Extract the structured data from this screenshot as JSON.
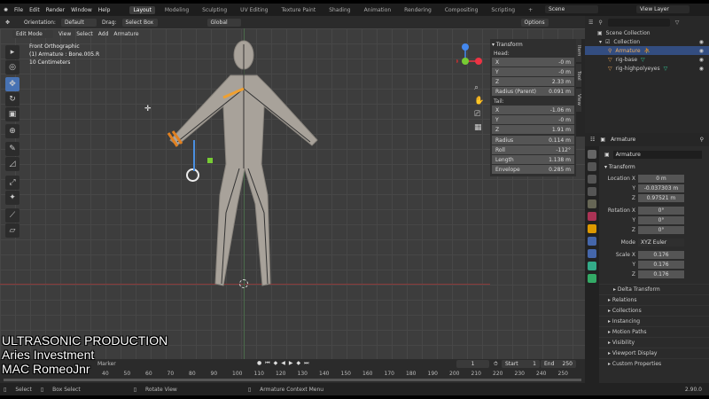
{
  "menu": {
    "items": [
      "File",
      "Edit",
      "Render",
      "Window",
      "Help"
    ],
    "workspaces": [
      "Layout",
      "Modeling",
      "Sculpting",
      "UV Editing",
      "Texture Paint",
      "Shading",
      "Animation",
      "Rendering",
      "Compositing",
      "Scripting",
      "+"
    ],
    "scene": "Scene",
    "view_layer": "View Layer"
  },
  "header": {
    "orientation_label": "Orientation:",
    "orientation": "Default",
    "drag_label": "Drag:",
    "drag": "Select Box",
    "transform_space": "Global",
    "options": "Options"
  },
  "viewport": {
    "mode": "Edit Mode",
    "menus": [
      "View",
      "Select",
      "Add",
      "Armature"
    ],
    "info": [
      "Front Orthographic",
      "(1) Armature : Bone.005.R",
      "10 Centimeters"
    ]
  },
  "npanel": {
    "tabs": [
      "Item",
      "Tool",
      "View"
    ],
    "title": "Transform",
    "head_label": "Head:",
    "head": [
      {
        "k": "X",
        "v": "-0 m"
      },
      {
        "k": "Y",
        "v": "-0 m"
      },
      {
        "k": "Z",
        "v": "2.33 m"
      }
    ],
    "radius_parent": {
      "k": "Radius (Parent)",
      "v": "0.091 m"
    },
    "tail_label": "Tail:",
    "tail": [
      {
        "k": "X",
        "v": "-1.06 m"
      },
      {
        "k": "Y",
        "v": "-0 m"
      },
      {
        "k": "Z",
        "v": "1.91 m"
      }
    ],
    "extra": [
      {
        "k": "Radius",
        "v": "0.114 m"
      },
      {
        "k": "Roll",
        "v": "-112°"
      },
      {
        "k": "Length",
        "v": "1.138 m"
      },
      {
        "k": "Envelope",
        "v": "0.285 m"
      }
    ]
  },
  "outliner": {
    "scene_collection": "Scene Collection",
    "collection": "Collection",
    "items": [
      "Armature",
      "rig-base",
      "rig-highpolyeyes"
    ]
  },
  "properties": {
    "object": "Armature",
    "name": "Armature",
    "transform": "Transform",
    "location": [
      {
        "k": "Location X",
        "v": "0 m"
      },
      {
        "k": "Y",
        "v": "-0.037303 m"
      },
      {
        "k": "Z",
        "v": "0.97521 m"
      }
    ],
    "rotation": [
      {
        "k": "Rotation X",
        "v": "0°"
      },
      {
        "k": "Y",
        "v": "0°"
      },
      {
        "k": "Z",
        "v": "0°"
      }
    ],
    "mode_label": "Mode",
    "mode": "XYZ Euler",
    "scale": [
      {
        "k": "Scale X",
        "v": "0.176"
      },
      {
        "k": "Y",
        "v": "0.176"
      },
      {
        "k": "Z",
        "v": "0.176"
      }
    ],
    "sections": [
      "Delta Transform",
      "Relations",
      "Collections",
      "Instancing",
      "Motion Paths",
      "Visibility",
      "Viewport Display",
      "Custom Properties"
    ]
  },
  "timeline": {
    "marker": "Marker",
    "current": "1",
    "start_label": "Start",
    "start": "1",
    "end_label": "End",
    "end": "250",
    "ticks": [
      "40",
      "50",
      "60",
      "70",
      "80",
      "90",
      "100",
      "110",
      "120",
      "130",
      "140",
      "150",
      "160",
      "170",
      "180",
      "190",
      "200",
      "210",
      "220",
      "230",
      "240",
      "250"
    ]
  },
  "status": {
    "items": [
      "Select",
      "Box Select",
      "Rotate View",
      "Armature Context Menu"
    ],
    "version": "2.90.0"
  },
  "watermark": [
    "ULTRASONIC PRODUCTION",
    "Aries Investment",
    "MAC RomeoJnr"
  ]
}
